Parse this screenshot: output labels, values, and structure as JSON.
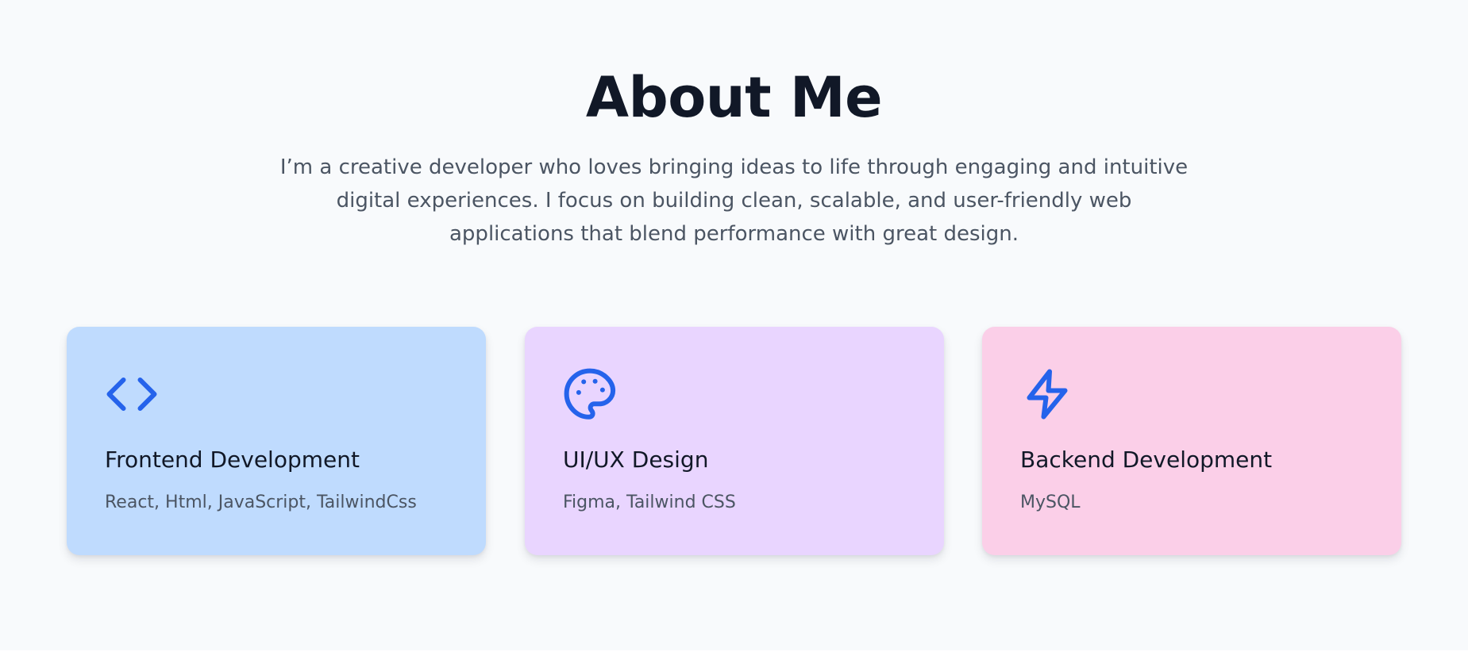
{
  "about": {
    "title": "About Me",
    "intro": "I’m a creative developer who loves bringing ideas to life through engaging and intuitive digital experiences. I focus on building clean, scalable, and user-friendly web applications that blend performance with great design."
  },
  "colors": {
    "page_background": "#f8fafc",
    "title_text": "#111827",
    "body_text": "#4b5563",
    "icon_accent": "#2563eb"
  },
  "cards": [
    {
      "icon": "code-icon",
      "title": "Frontend Development",
      "skills": "React, Html, JavaScript, TailwindCss",
      "background": "#bfdbfe"
    },
    {
      "icon": "palette-icon",
      "title": "UI/UX Design",
      "skills": "Figma, Tailwind CSS",
      "background": "#e9d5ff"
    },
    {
      "icon": "lightning-icon",
      "title": "Backend Development",
      "skills": "MySQL",
      "background": "#fbcfe8"
    }
  ]
}
